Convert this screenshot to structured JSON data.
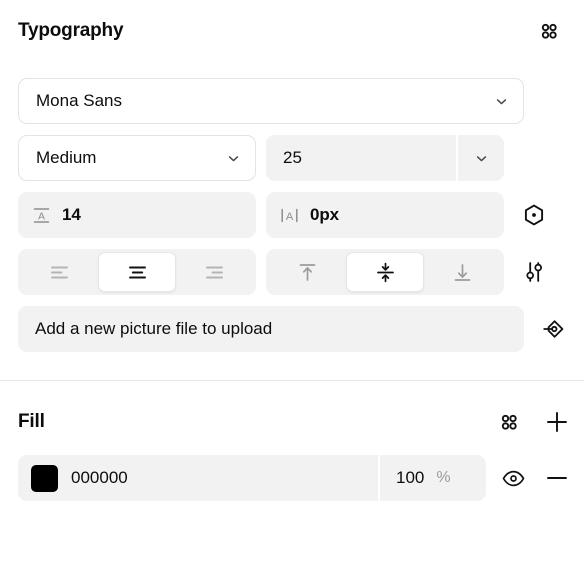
{
  "typography": {
    "title": "Typography",
    "header_icon": "grid-dots-icon",
    "font_family": {
      "value": "Mona Sans",
      "icon": "chevron-down-icon"
    },
    "font_weight": {
      "value": "Medium",
      "icon": "chevron-down-icon"
    },
    "font_size": {
      "value": "25",
      "icon": "chevron-down-icon"
    },
    "line_height": {
      "icon": "line-height-icon",
      "value": "14"
    },
    "letter_spacing": {
      "icon": "letter-spacing-icon",
      "value": "0px",
      "trail_icon": "hexagon-dot-icon"
    },
    "text_align": {
      "options": [
        {
          "name": "align-left",
          "label": "Align left"
        },
        {
          "name": "align-center",
          "label": "Align center"
        },
        {
          "name": "align-right",
          "label": "Align right"
        }
      ],
      "selected": "align-center"
    },
    "vertical_align": {
      "options": [
        {
          "name": "align-top",
          "label": "Align top"
        },
        {
          "name": "align-middle",
          "label": "Align middle"
        },
        {
          "name": "align-bottom",
          "label": "Align bottom"
        }
      ],
      "selected": "align-middle",
      "trail_icon": "sliders-icon"
    },
    "content_input": {
      "value": "Add a new picture file to upload",
      "placeholder": "Add a new picture file to upload",
      "trail_icon": "component-icon"
    }
  },
  "fill": {
    "title": "Fill",
    "grid_icon": "grid-dots-icon",
    "add_icon": "plus-icon",
    "items": [
      {
        "swatch_color": "#000000",
        "hex": "000000",
        "opacity": "100",
        "opacity_unit": "%",
        "visibility_icon": "eye-icon",
        "remove_icon": "minus-icon"
      }
    ]
  }
}
